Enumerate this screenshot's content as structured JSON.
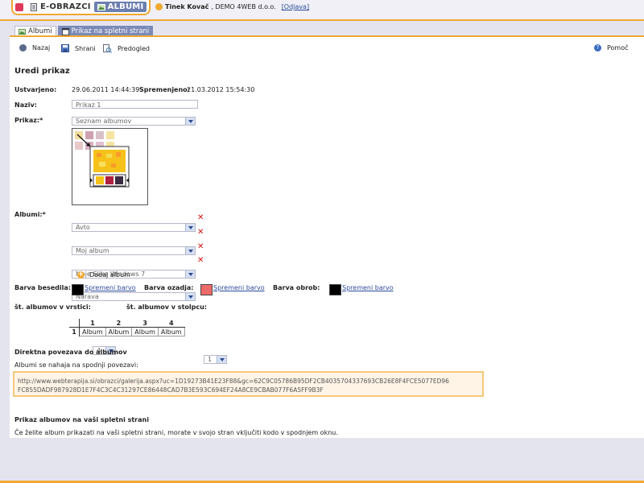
{
  "app": {
    "tabs": [
      {
        "label": "E-OBRAZCI",
        "icon": "document-icon"
      },
      {
        "label": "ALBUMI",
        "icon": "image-icon"
      }
    ],
    "user": {
      "name": "Tinek Kovač",
      "company": ", DEMO 4WEB d.o.o.",
      "logout": "[Odjava]"
    }
  },
  "section_tabs": [
    {
      "label": "Albumi"
    },
    {
      "label": "Prikaz na spletni strani"
    }
  ],
  "toolbar": {
    "back": "Nazaj",
    "save": "Shrani",
    "preview": "Predogled",
    "help": "Pomoč"
  },
  "page": {
    "title": "Uredi prikaz",
    "created_label": "Ustvarjeno:",
    "created_value": "29.06.2011 14:44:39",
    "modified_label": "Spremenjeno:",
    "modified_value": "21.03.2012 15:54:30",
    "name_label": "Naziv:",
    "name_placeholder": "Prikaz 1",
    "display_label": "Prikaz:*",
    "display_value": "Seznam albumov",
    "albums_label": "Albumi:*",
    "albums": [
      "Avto",
      "Moj album",
      "Moje Slike Windows 7",
      "Narava"
    ],
    "add_album": "Dodaj album",
    "text_color_label": "Barva besedila:",
    "bg_color_label": "Barva ozadja:",
    "border_color_label": "Barva obrob:",
    "change_color": "Spremeni barvo",
    "colors": {
      "text": "#000000",
      "background": "#ee6a6a",
      "border": "#000000",
      "accent": "#f0a830"
    },
    "per_row_label": "št. albumov v vrstici:",
    "per_row_value": "4",
    "per_col_label": "št. albumov v stolpcu:",
    "per_col_value": "1",
    "grid": {
      "col_headers": [
        "1",
        "2",
        "3",
        "4"
      ],
      "row_header": "1",
      "cell": "Album"
    },
    "direct_link_title": "Direktna povezava do albumov",
    "direct_link_text": "Albumi se nahaja na spodnji povezavi:",
    "url_line1": "http://www.webterapija.si/obrazci/galerija.aspx?uc=1D19273B41E23F88&gc=62C9C05786B95DF2CB4035704337693CB26E8F4FCE5077ED96",
    "url_line2": "FC855DADF987928D1E7F4C3C4C31297CE86448CAD7B3E593C694EF24A8CE9CBAB077F6A5FF9B3F",
    "embed_title": "Prikaz albumov na vaši spletni strani",
    "embed_text": "Če želite album prikazati na vaši spletni strani, morate v svojo stran vključiti kodo v spodnjem oknu."
  }
}
